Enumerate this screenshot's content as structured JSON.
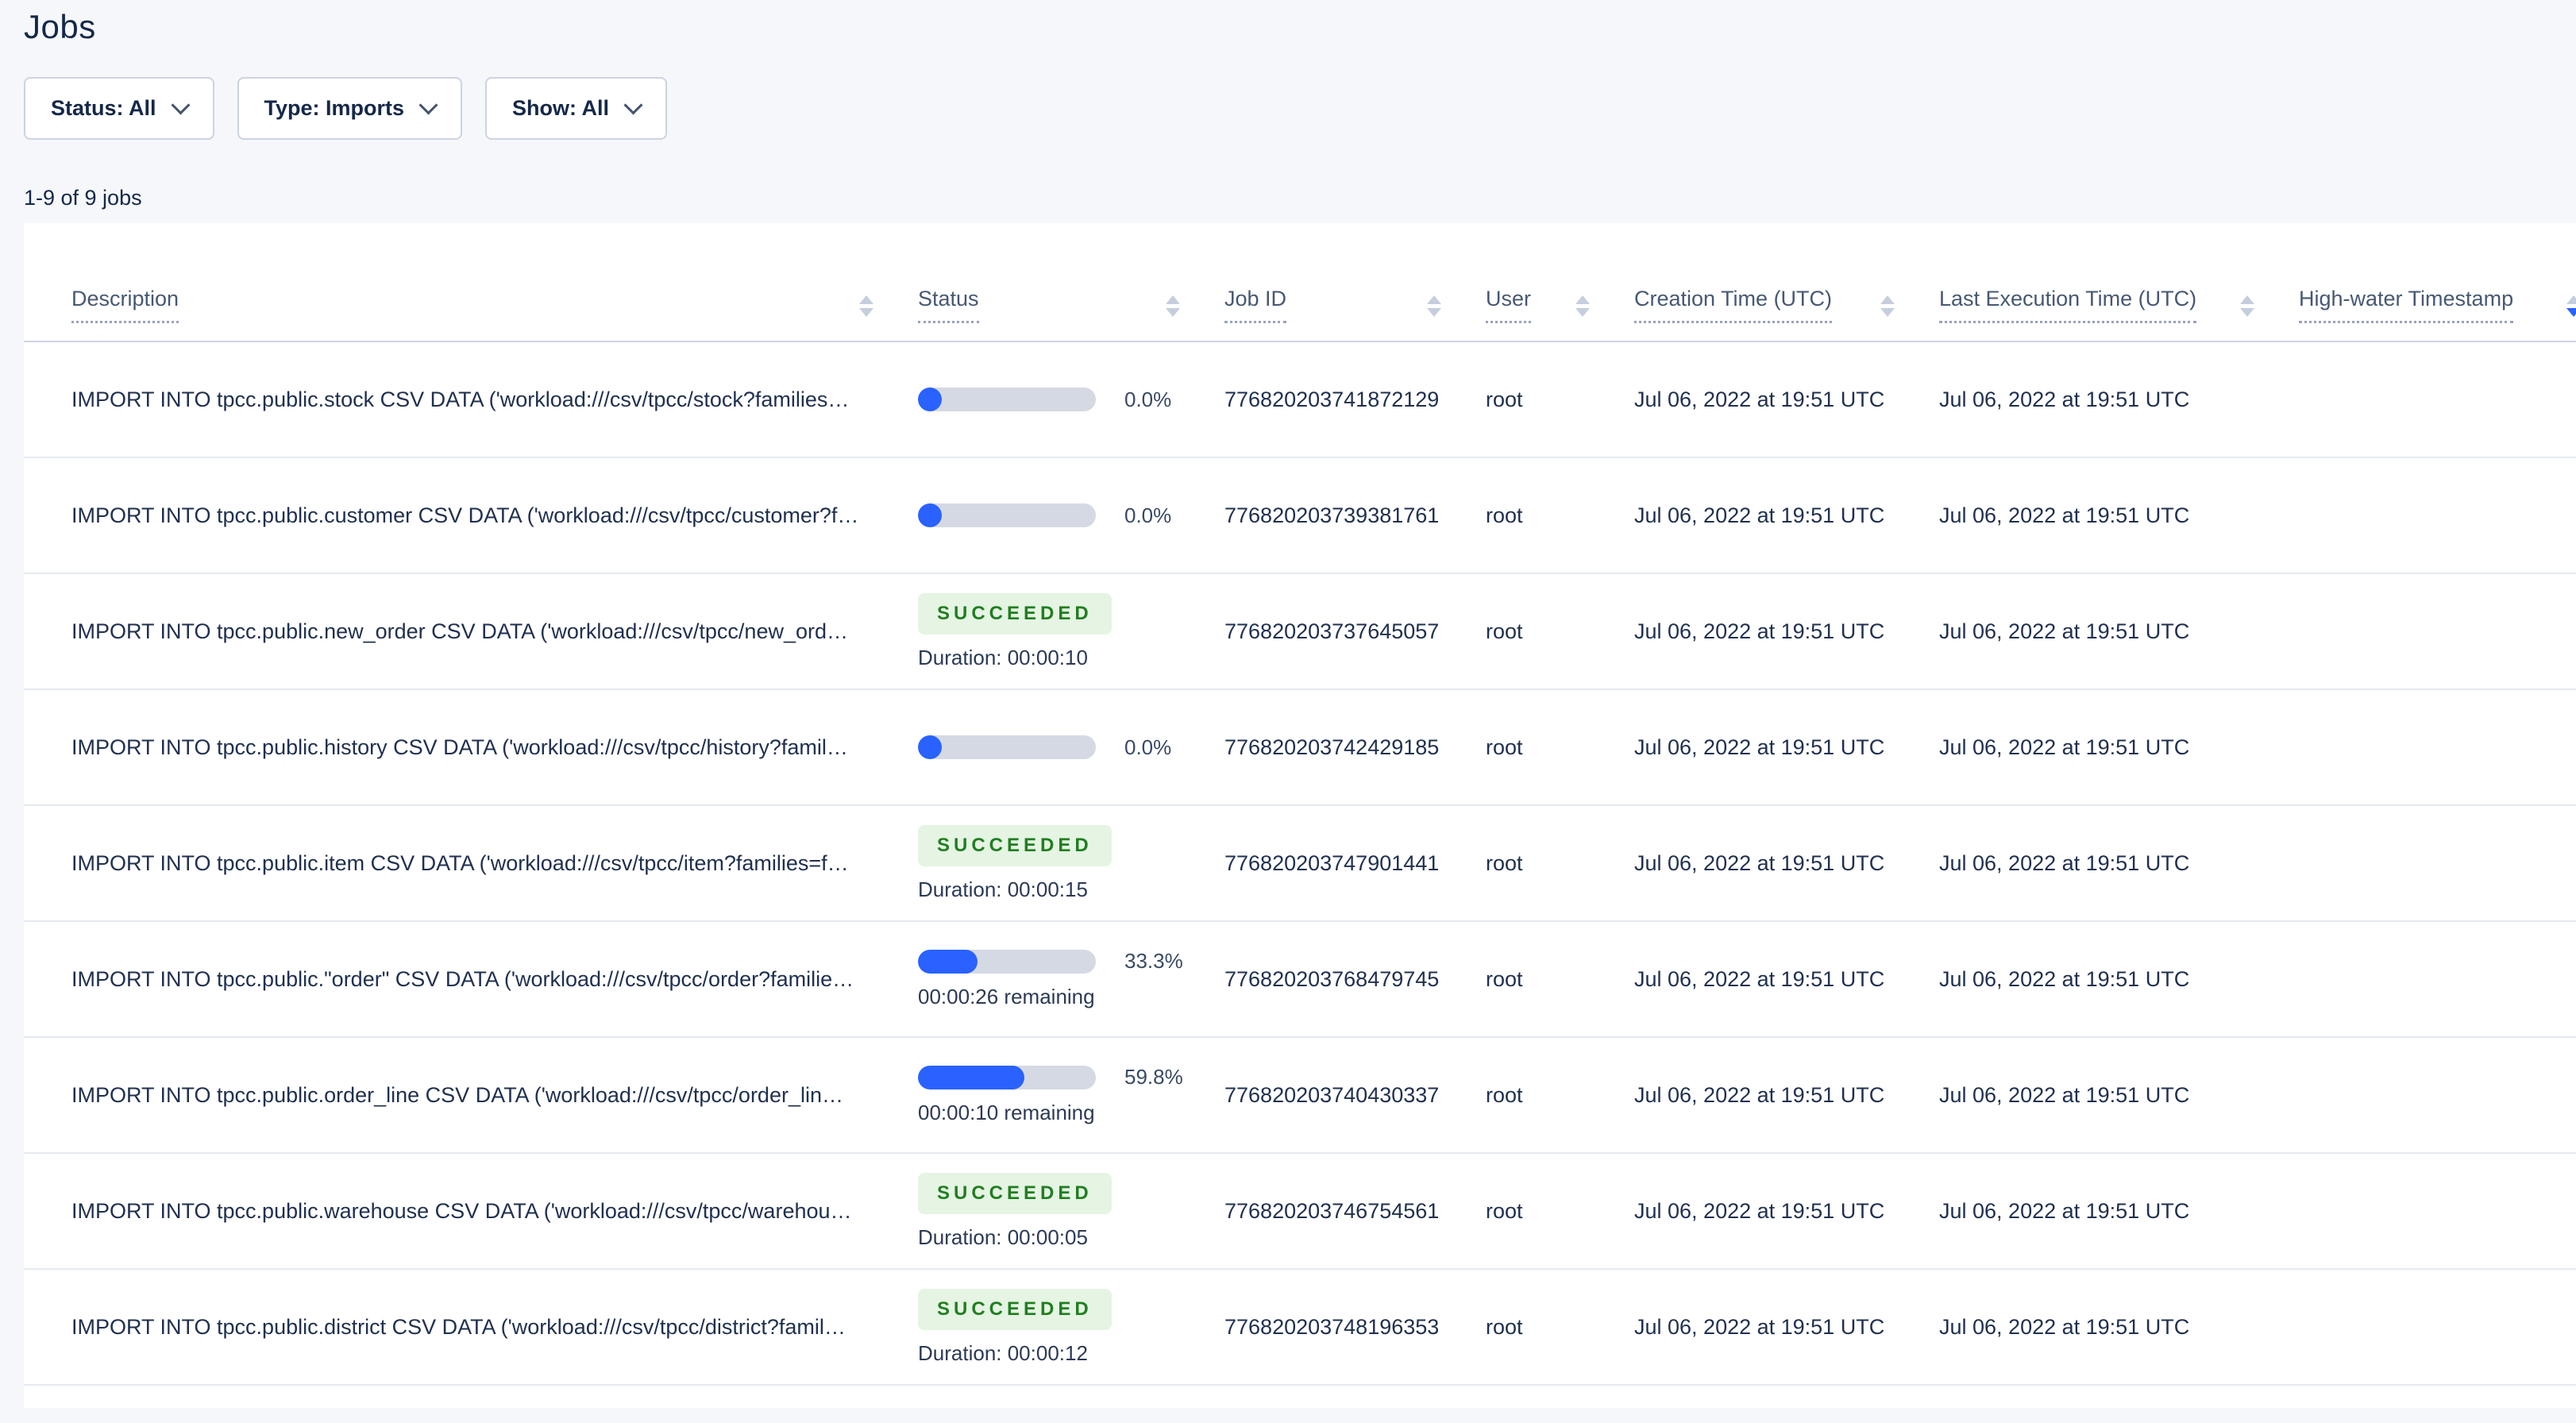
{
  "page": {
    "title": "Jobs",
    "results_count": "1-9 of 9 jobs"
  },
  "filters": [
    {
      "label": "Status: All"
    },
    {
      "label": "Type: Imports"
    },
    {
      "label": "Show: All"
    }
  ],
  "icons": {
    "filter_chevron": "chevron-down",
    "column_sort": "sort-carets"
  },
  "colors": {
    "page_bg": "#f5f7fa",
    "card_bg": "#ffffff",
    "accent_blue": "#2962ff",
    "progress_track": "#d5d9e3",
    "success_bg": "#e5f4e3",
    "success_text": "#217e21",
    "header_text": "#475872",
    "body_text": "#20304f"
  },
  "table": {
    "columns": [
      "Description",
      "Status",
      "Job ID",
      "User",
      "Creation Time (UTC)",
      "Last Execution Time (UTC)",
      "High-water Timestamp"
    ],
    "sort": {
      "column_index": 6,
      "direction": "desc"
    },
    "rows": [
      {
        "description": "IMPORT INTO tpcc.public.stock CSV DATA ('workload:///csv/tpcc/stock?families…",
        "status": "progress",
        "percent": "0.0%",
        "remaining": "",
        "job_id": "776820203741872129",
        "user": "root",
        "creation_time": "Jul 06, 2022 at 19:51 UTC",
        "last_execution_time": "Jul 06, 2022 at 19:51 UTC",
        "high_water_timestamp": ""
      },
      {
        "description": "IMPORT INTO tpcc.public.customer CSV DATA ('workload:///csv/tpcc/customer?f…",
        "status": "progress",
        "percent": "0.0%",
        "remaining": "",
        "job_id": "776820203739381761",
        "user": "root",
        "creation_time": "Jul 06, 2022 at 19:51 UTC",
        "last_execution_time": "Jul 06, 2022 at 19:51 UTC",
        "high_water_timestamp": ""
      },
      {
        "description": "IMPORT INTO tpcc.public.new_order CSV DATA ('workload:///csv/tpcc/new_ord…",
        "status": "succeeded",
        "badge": "SUCCEEDED",
        "duration": "Duration: 00:00:10",
        "job_id": "776820203737645057",
        "user": "root",
        "creation_time": "Jul 06, 2022 at 19:51 UTC",
        "last_execution_time": "Jul 06, 2022 at 19:51 UTC",
        "high_water_timestamp": ""
      },
      {
        "description": "IMPORT INTO tpcc.public.history CSV DATA ('workload:///csv/tpcc/history?famil…",
        "status": "progress",
        "percent": "0.0%",
        "remaining": "",
        "job_id": "776820203742429185",
        "user": "root",
        "creation_time": "Jul 06, 2022 at 19:51 UTC",
        "last_execution_time": "Jul 06, 2022 at 19:51 UTC",
        "high_water_timestamp": ""
      },
      {
        "description": "IMPORT INTO tpcc.public.item CSV DATA ('workload:///csv/tpcc/item?families=f…",
        "status": "succeeded",
        "badge": "SUCCEEDED",
        "duration": "Duration: 00:00:15",
        "job_id": "776820203747901441",
        "user": "root",
        "creation_time": "Jul 06, 2022 at 19:51 UTC",
        "last_execution_time": "Jul 06, 2022 at 19:51 UTC",
        "high_water_timestamp": ""
      },
      {
        "description": "IMPORT INTO tpcc.public.\"order\" CSV DATA ('workload:///csv/tpcc/order?familie…",
        "status": "progress",
        "percent": "33.3%",
        "remaining": "00:00:26 remaining",
        "job_id": "776820203768479745",
        "user": "root",
        "creation_time": "Jul 06, 2022 at 19:51 UTC",
        "last_execution_time": "Jul 06, 2022 at 19:51 UTC",
        "high_water_timestamp": ""
      },
      {
        "description": "IMPORT INTO tpcc.public.order_line CSV DATA ('workload:///csv/tpcc/order_lin…",
        "status": "progress",
        "percent": "59.8%",
        "remaining": "00:00:10 remaining",
        "job_id": "776820203740430337",
        "user": "root",
        "creation_time": "Jul 06, 2022 at 19:51 UTC",
        "last_execution_time": "Jul 06, 2022 at 19:51 UTC",
        "high_water_timestamp": ""
      },
      {
        "description": "IMPORT INTO tpcc.public.warehouse CSV DATA ('workload:///csv/tpcc/warehou…",
        "status": "succeeded",
        "badge": "SUCCEEDED",
        "duration": "Duration: 00:00:05",
        "job_id": "776820203746754561",
        "user": "root",
        "creation_time": "Jul 06, 2022 at 19:51 UTC",
        "last_execution_time": "Jul 06, 2022 at 19:51 UTC",
        "high_water_timestamp": ""
      },
      {
        "description": "IMPORT INTO tpcc.public.district CSV DATA ('workload:///csv/tpcc/district?famil…",
        "status": "succeeded",
        "badge": "SUCCEEDED",
        "duration": "Duration: 00:00:12",
        "job_id": "776820203748196353",
        "user": "root",
        "creation_time": "Jul 06, 2022 at 19:51 UTC",
        "last_execution_time": "Jul 06, 2022 at 19:51 UTC",
        "high_water_timestamp": ""
      }
    ]
  }
}
